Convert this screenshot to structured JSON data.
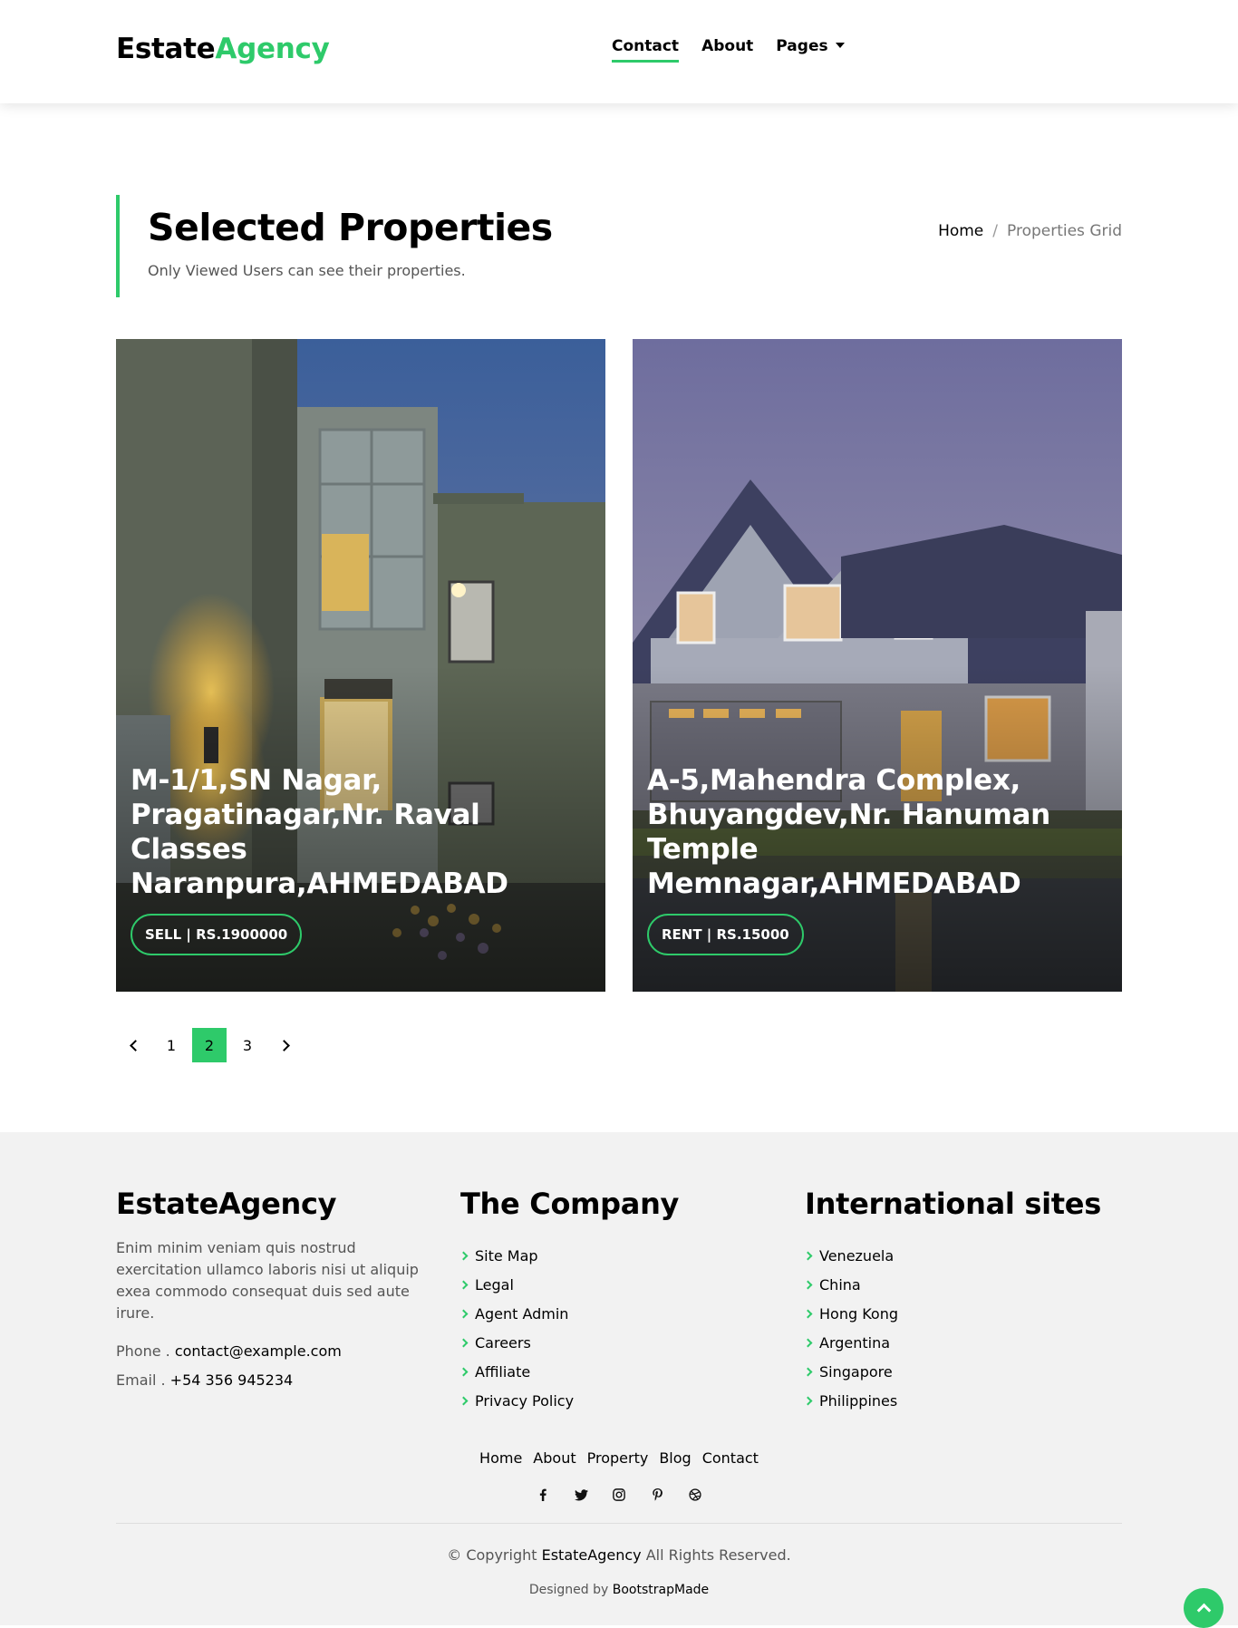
{
  "navbar": {
    "brand_main": "Estate",
    "brand_accent": "Agency",
    "links": [
      "Contact",
      "About",
      "Pages"
    ]
  },
  "intro": {
    "title": "Selected Properties",
    "subtitle": "Only Viewed Users can see their properties.",
    "breadcrumb": {
      "home": "Home",
      "separator": "/",
      "current": "Properties Grid"
    }
  },
  "properties": [
    {
      "address_lines": [
        "M-1/1,SN Nagar,",
        "Pragatinagar,Nr. Raval Classes",
        "Naranpura,AHMEDABAD"
      ],
      "badge": "SELL | RS.1900000"
    },
    {
      "address_lines": [
        "A-5,Mahendra Complex,",
        "Bhuyangdev,Nr. Hanuman",
        "Temple",
        "Memnagar,AHMEDABAD"
      ],
      "badge": "RENT | RS.15000"
    }
  ],
  "pagination": {
    "pages": [
      "1",
      "2",
      "3"
    ],
    "active": "2"
  },
  "footer": {
    "about": {
      "title": "EstateAgency",
      "description": "Enim minim veniam quis nostrud exercitation ullamco laboris nisi ut aliquip exea commodo consequat duis sed aute irure.",
      "phone_label": "Phone .",
      "phone_value": "contact@example.com",
      "email_label": "Email .",
      "email_value": "+54 356 945234"
    },
    "company": {
      "title": "The Company",
      "links": [
        "Site Map",
        "Legal",
        "Agent Admin",
        "Careers",
        "Affiliate",
        "Privacy Policy"
      ]
    },
    "international": {
      "title": "International sites",
      "links": [
        "Venezuela",
        "China",
        "Hong Kong",
        "Argentina",
        "Singapore",
        "Philippines"
      ]
    },
    "nav": [
      "Home",
      "About",
      "Property",
      "Blog",
      "Contact"
    ],
    "social_icons": [
      "facebook-icon",
      "twitter-icon",
      "instagram-icon",
      "pinterest-icon",
      "dribbble-icon"
    ],
    "copyright_prefix": "© Copyright",
    "copyright_brand": "EstateAgency",
    "copyright_suffix": "All Rights Reserved.",
    "designed_prefix": "Designed by",
    "designed_by": "BootstrapMade"
  },
  "colors": {
    "accent": "#2eca6a",
    "footer_bg": "#f2f2f2"
  }
}
